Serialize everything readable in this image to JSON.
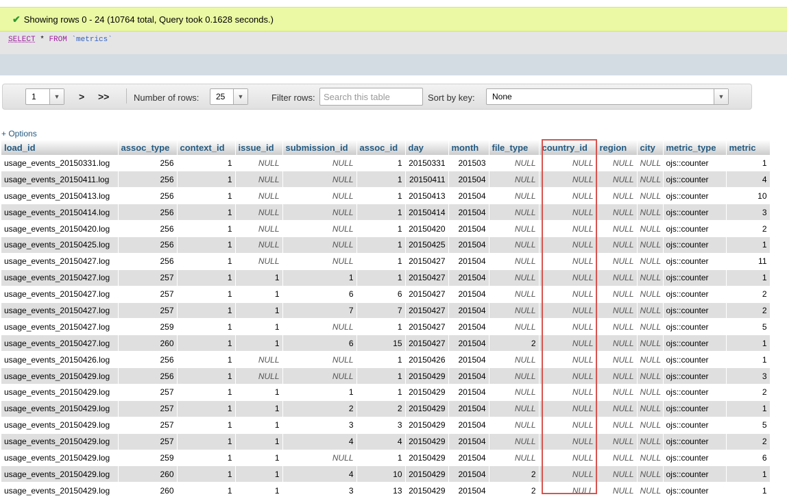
{
  "message": {
    "icon": "check-icon",
    "text": "Showing rows 0 - 24 (10764 total, Query took 0.1628 seconds.)"
  },
  "sql": {
    "select_kw": "SELECT",
    "star": "*",
    "from_kw": "FROM",
    "table": "`metrics`"
  },
  "navigation": {
    "page_value": "1",
    "next_label": ">",
    "last_label": ">>",
    "rows_label": "Number of rows:",
    "rows_value": "25",
    "filter_label": "Filter rows:",
    "filter_placeholder": "Search this table",
    "sort_label": "Sort by key:",
    "sort_value": "None"
  },
  "options_label": "+ Options",
  "table": {
    "columns": [
      "load_id",
      "assoc_type",
      "context_id",
      "issue_id",
      "submission_id",
      "assoc_id",
      "day",
      "month",
      "file_type",
      "country_id",
      "region",
      "city",
      "metric_type",
      "metric"
    ],
    "rows": [
      [
        "usage_events_20150331.log",
        "256",
        "1",
        "NULL",
        "NULL",
        "1",
        "20150331",
        "201503",
        "NULL",
        "NULL",
        "NULL",
        "NULL",
        "ojs::counter",
        "1"
      ],
      [
        "usage_events_20150411.log",
        "256",
        "1",
        "NULL",
        "NULL",
        "1",
        "20150411",
        "201504",
        "NULL",
        "NULL",
        "NULL",
        "NULL",
        "ojs::counter",
        "4"
      ],
      [
        "usage_events_20150413.log",
        "256",
        "1",
        "NULL",
        "NULL",
        "1",
        "20150413",
        "201504",
        "NULL",
        "NULL",
        "NULL",
        "NULL",
        "ojs::counter",
        "10"
      ],
      [
        "usage_events_20150414.log",
        "256",
        "1",
        "NULL",
        "NULL",
        "1",
        "20150414",
        "201504",
        "NULL",
        "NULL",
        "NULL",
        "NULL",
        "ojs::counter",
        "3"
      ],
      [
        "usage_events_20150420.log",
        "256",
        "1",
        "NULL",
        "NULL",
        "1",
        "20150420",
        "201504",
        "NULL",
        "NULL",
        "NULL",
        "NULL",
        "ojs::counter",
        "2"
      ],
      [
        "usage_events_20150425.log",
        "256",
        "1",
        "NULL",
        "NULL",
        "1",
        "20150425",
        "201504",
        "NULL",
        "NULL",
        "NULL",
        "NULL",
        "ojs::counter",
        "1"
      ],
      [
        "usage_events_20150427.log",
        "256",
        "1",
        "NULL",
        "NULL",
        "1",
        "20150427",
        "201504",
        "NULL",
        "NULL",
        "NULL",
        "NULL",
        "ojs::counter",
        "11"
      ],
      [
        "usage_events_20150427.log",
        "257",
        "1",
        "1",
        "1",
        "1",
        "20150427",
        "201504",
        "NULL",
        "NULL",
        "NULL",
        "NULL",
        "ojs::counter",
        "1"
      ],
      [
        "usage_events_20150427.log",
        "257",
        "1",
        "1",
        "6",
        "6",
        "20150427",
        "201504",
        "NULL",
        "NULL",
        "NULL",
        "NULL",
        "ojs::counter",
        "2"
      ],
      [
        "usage_events_20150427.log",
        "257",
        "1",
        "1",
        "7",
        "7",
        "20150427",
        "201504",
        "NULL",
        "NULL",
        "NULL",
        "NULL",
        "ojs::counter",
        "2"
      ],
      [
        "usage_events_20150427.log",
        "259",
        "1",
        "1",
        "NULL",
        "1",
        "20150427",
        "201504",
        "NULL",
        "NULL",
        "NULL",
        "NULL",
        "ojs::counter",
        "5"
      ],
      [
        "usage_events_20150427.log",
        "260",
        "1",
        "1",
        "6",
        "15",
        "20150427",
        "201504",
        "2",
        "NULL",
        "NULL",
        "NULL",
        "ojs::counter",
        "1"
      ],
      [
        "usage_events_20150426.log",
        "256",
        "1",
        "NULL",
        "NULL",
        "1",
        "20150426",
        "201504",
        "NULL",
        "NULL",
        "NULL",
        "NULL",
        "ojs::counter",
        "1"
      ],
      [
        "usage_events_20150429.log",
        "256",
        "1",
        "NULL",
        "NULL",
        "1",
        "20150429",
        "201504",
        "NULL",
        "NULL",
        "NULL",
        "NULL",
        "ojs::counter",
        "3"
      ],
      [
        "usage_events_20150429.log",
        "257",
        "1",
        "1",
        "1",
        "1",
        "20150429",
        "201504",
        "NULL",
        "NULL",
        "NULL",
        "NULL",
        "ojs::counter",
        "2"
      ],
      [
        "usage_events_20150429.log",
        "257",
        "1",
        "1",
        "2",
        "2",
        "20150429",
        "201504",
        "NULL",
        "NULL",
        "NULL",
        "NULL",
        "ojs::counter",
        "1"
      ],
      [
        "usage_events_20150429.log",
        "257",
        "1",
        "1",
        "3",
        "3",
        "20150429",
        "201504",
        "NULL",
        "NULL",
        "NULL",
        "NULL",
        "ojs::counter",
        "5"
      ],
      [
        "usage_events_20150429.log",
        "257",
        "1",
        "1",
        "4",
        "4",
        "20150429",
        "201504",
        "NULL",
        "NULL",
        "NULL",
        "NULL",
        "ojs::counter",
        "2"
      ],
      [
        "usage_events_20150429.log",
        "259",
        "1",
        "1",
        "NULL",
        "1",
        "20150429",
        "201504",
        "NULL",
        "NULL",
        "NULL",
        "NULL",
        "ojs::counter",
        "6"
      ],
      [
        "usage_events_20150429.log",
        "260",
        "1",
        "1",
        "4",
        "10",
        "20150429",
        "201504",
        "2",
        "NULL",
        "NULL",
        "NULL",
        "ojs::counter",
        "1"
      ],
      [
        "usage_events_20150429.log",
        "260",
        "1",
        "1",
        "3",
        "13",
        "20150429",
        "201504",
        "2",
        "NULL",
        "NULL",
        "NULL",
        "ojs::counter",
        "1"
      ]
    ]
  },
  "highlight_color": "#d9534f"
}
